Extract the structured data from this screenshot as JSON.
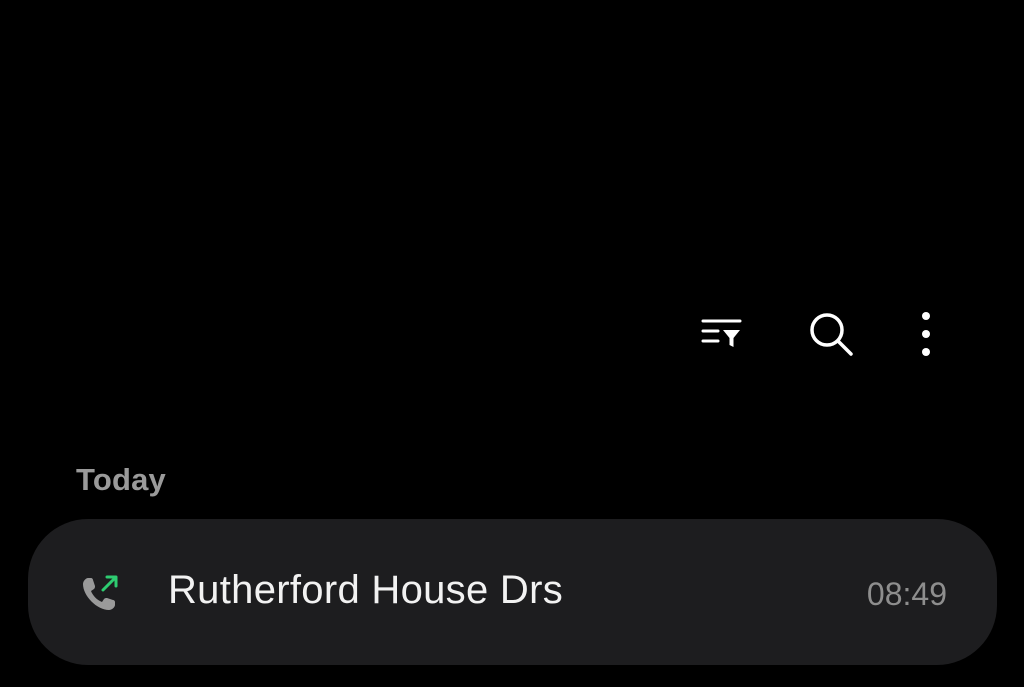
{
  "toolbar": {
    "filter_icon": "filter-list-icon",
    "search_icon": "search-icon",
    "more_icon": "more-vertical-icon"
  },
  "section": {
    "title": "Today"
  },
  "calls": [
    {
      "name": "Rutherford House Drs",
      "time": "08:49",
      "type": "outgoing",
      "icon": "outgoing-call-icon"
    }
  ],
  "colors": {
    "background": "#000000",
    "card": "#1d1d1f",
    "outgoing_arrow": "#2ecc71",
    "phone_glyph": "#9a9a9a"
  }
}
